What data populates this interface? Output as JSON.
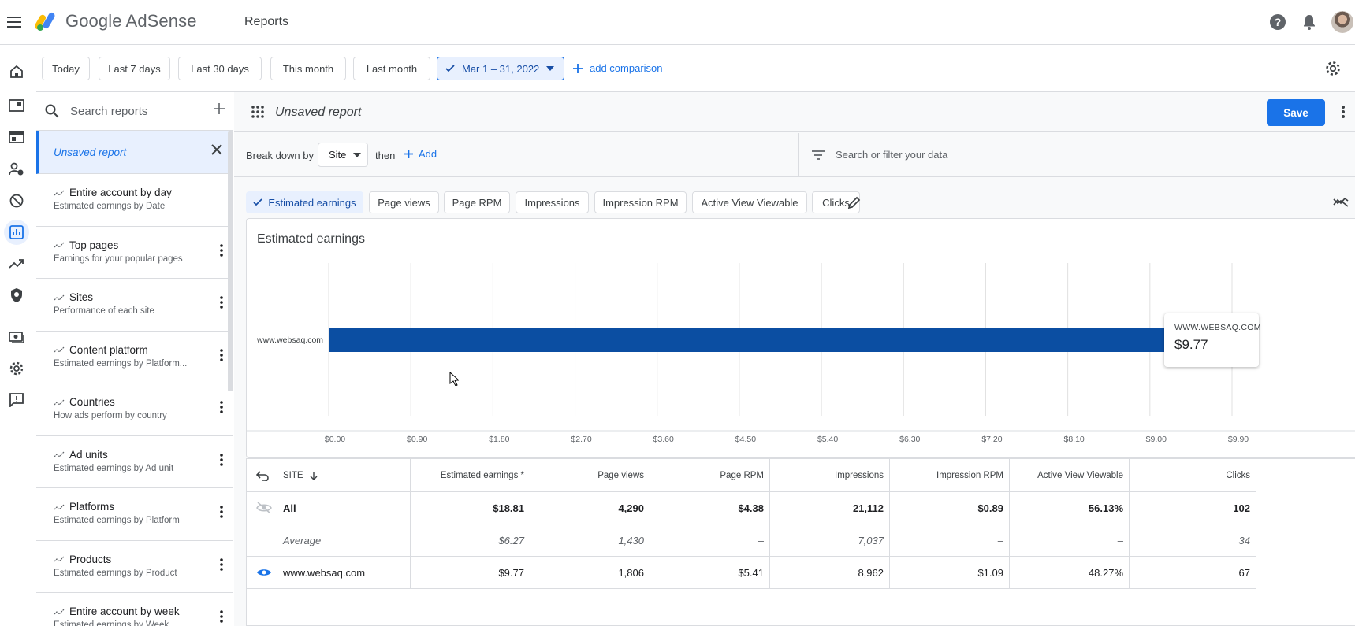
{
  "app": {
    "brand": "Google AdSense",
    "page_title": "Reports"
  },
  "date_filters": {
    "today": "Today",
    "last7": "Last 7 days",
    "last30": "Last 30 days",
    "this_month": "This month",
    "last_month": "Last month",
    "selected_range": "Mar 1 – 31, 2022",
    "add_comparison": "add comparison"
  },
  "sidebar": {
    "search_placeholder": "Search reports",
    "unsaved_label": "Unsaved report",
    "reports": [
      {
        "title": "Entire account by day",
        "subtitle": "Estimated earnings by Date"
      },
      {
        "title": "Top pages",
        "subtitle": "Earnings for your popular pages"
      },
      {
        "title": "Sites",
        "subtitle": "Performance of each site"
      },
      {
        "title": "Content platform",
        "subtitle": "Estimated earnings by Platform..."
      },
      {
        "title": "Countries",
        "subtitle": "How ads perform by country"
      },
      {
        "title": "Ad units",
        "subtitle": "Estimated earnings by Ad unit"
      },
      {
        "title": "Platforms",
        "subtitle": "Estimated earnings by Platform"
      },
      {
        "title": "Products",
        "subtitle": "Estimated earnings by Product"
      },
      {
        "title": "Entire account by week",
        "subtitle": "Estimated earnings by Week"
      }
    ]
  },
  "report": {
    "name": "Unsaved report",
    "save_label": "Save",
    "breakdown_label": "Break down by",
    "breakdown_value": "Site",
    "then_label": "then",
    "add_label": "Add",
    "filter_placeholder": "Search or filter your data"
  },
  "metrics": [
    "Estimated earnings",
    "Page views",
    "Page RPM",
    "Impressions",
    "Impression RPM",
    "Active View Viewable",
    "Clicks"
  ],
  "chart_data": {
    "type": "bar",
    "orientation": "horizontal",
    "title": "Estimated earnings",
    "categories": [
      "www.websaq.com"
    ],
    "values": [
      9.77
    ],
    "xlim": [
      0,
      9.9
    ],
    "x_ticks": [
      "$0.00",
      "$0.90",
      "$1.80",
      "$2.70",
      "$3.60",
      "$4.50",
      "$5.40",
      "$6.30",
      "$7.20",
      "$8.10",
      "$9.00",
      "$9.90"
    ],
    "grid": true,
    "bar_color": "#0b4ea2",
    "tooltip": {
      "key": "WWW.WEBSAQ.COM",
      "value": "$9.77"
    }
  },
  "table": {
    "headers": [
      "SITE",
      "Estimated earnings *",
      "Page views",
      "Page RPM",
      "Impressions",
      "Impression RPM",
      "Active View Viewable",
      "Clicks"
    ],
    "rows": [
      {
        "label": "All",
        "values": [
          "$18.81",
          "4,290",
          "$4.38",
          "21,112",
          "$0.89",
          "56.13%",
          "102"
        ]
      },
      {
        "label": "Average",
        "values": [
          "$6.27",
          "1,430",
          "–",
          "7,037",
          "–",
          "–",
          "34"
        ]
      },
      {
        "label": "www.websaq.com",
        "values": [
          "$9.77",
          "1,806",
          "$5.41",
          "8,962",
          "$1.09",
          "48.27%",
          "67"
        ]
      }
    ]
  },
  "colors": {
    "accent": "#1a73e8",
    "bar": "#0b4ea2"
  }
}
